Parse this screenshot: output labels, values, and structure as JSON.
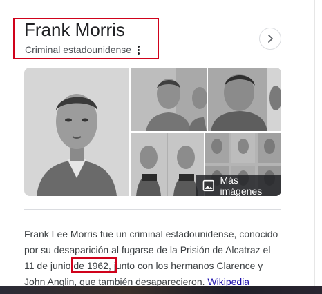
{
  "panel": {
    "title": "Frank Morris",
    "subtitle": "Criminal estadounidense",
    "more_images_label": "Más imágenes",
    "icons": {
      "more_options": "vertical-dots-icon",
      "next": "chevron-right-icon",
      "image": "image-icon"
    }
  },
  "description": {
    "line1": "Frank Lee Morris fue un criminal estadounidense, conocido",
    "line2": "por su desaparición al fugarse de la Prisión de Alcatraz el",
    "line3": "11 de junio de 1962, junto con los hermanos Clarence y",
    "line4": "John Anglin, que también desaparecieron.",
    "source_link": "Wikipedia"
  },
  "colors": {
    "highlight": "#d0021b",
    "link": "#1a0dab"
  }
}
